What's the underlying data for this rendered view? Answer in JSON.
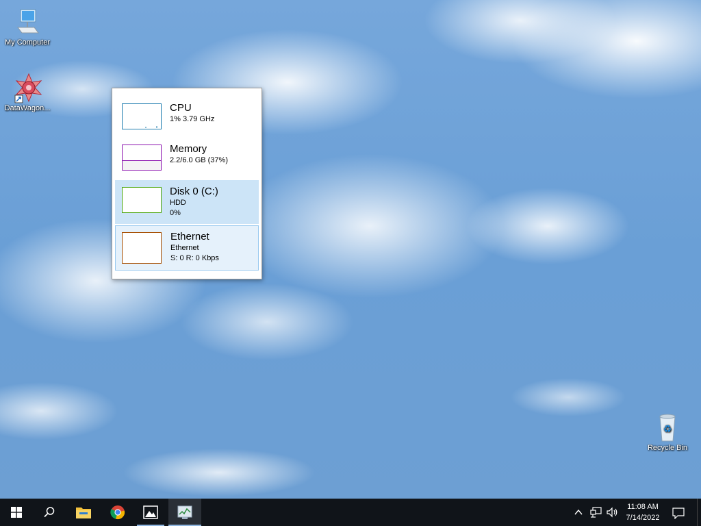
{
  "desktop": {
    "icons": [
      {
        "label": "My Computer"
      },
      {
        "label": "DataWagon..."
      },
      {
        "label": "Recycle Bin"
      }
    ]
  },
  "flyout": {
    "items": [
      {
        "title": "CPU",
        "line1": "1%  3.79 GHz",
        "line2": "",
        "color": "#1c7bae",
        "state": "normal"
      },
      {
        "title": "Memory",
        "line1": "2.2/6.0 GB (37%)",
        "line2": "",
        "color": "#8b12ae",
        "state": "normal",
        "fill_fraction": 0.37
      },
      {
        "title": "Disk 0 (C:)",
        "line1": "HDD",
        "line2": "0%",
        "color": "#4da60c",
        "state": "selected"
      },
      {
        "title": "Ethernet",
        "line1": "Ethernet",
        "line2": "S: 0  R: 0 Kbps",
        "color": "#a74f01",
        "state": "hovered"
      }
    ]
  },
  "taskbar": {
    "apps": [
      {
        "name": "start"
      },
      {
        "name": "search"
      },
      {
        "name": "file-explorer"
      },
      {
        "name": "chrome"
      },
      {
        "name": "photos"
      },
      {
        "name": "task-manager"
      }
    ],
    "clock": {
      "time": "11:08 AM",
      "date": "7/14/2022"
    }
  }
}
